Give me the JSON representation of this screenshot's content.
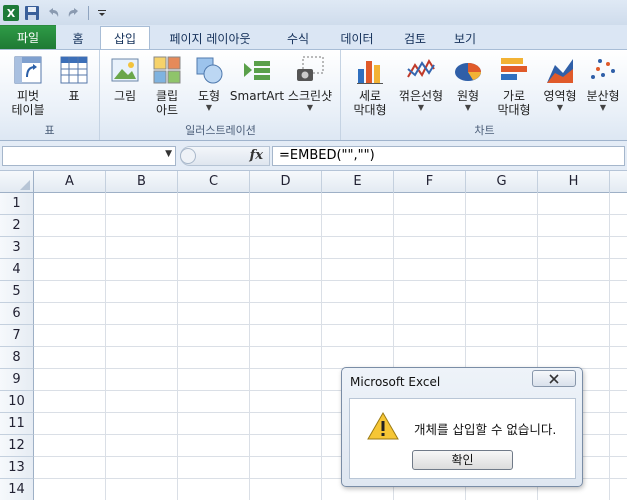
{
  "qat": {
    "icons": [
      "excel-logo-icon",
      "save-icon",
      "undo-icon",
      "redo-icon",
      "customize-qat-icon"
    ]
  },
  "tabs": {
    "file": "파일",
    "items": [
      "홈",
      "삽입",
      "페이지 레이아웃",
      "수식",
      "데이터",
      "검토",
      "보기"
    ],
    "active": "삽입"
  },
  "ribbon": {
    "groups": {
      "tables": {
        "label": "표",
        "pivot_line1": "피벗",
        "pivot_line2": "테이블",
        "table": "표"
      },
      "illustrations": {
        "label": "일러스트레이션",
        "picture": "그림",
        "clipart_line1": "클립",
        "clipart_line2": "아트",
        "shapes": "도형",
        "smartart": "SmartArt",
        "screenshot": "스크린샷"
      },
      "charts": {
        "label": "차트",
        "column_line1": "세로",
        "column_line2": "막대형",
        "line": "꺾은선형",
        "pie": "원형",
        "bar_line1": "가로",
        "bar_line2": "막대형",
        "area": "영역형",
        "scatter": "분산형"
      }
    }
  },
  "formula_bar": {
    "name_box": "",
    "fx": "fx",
    "formula": "=EMBED(\"\",\"\")"
  },
  "grid": {
    "columns": [
      "A",
      "B",
      "C",
      "D",
      "E",
      "F",
      "G",
      "H"
    ],
    "rows": [
      "1",
      "2",
      "3",
      "4",
      "5",
      "6",
      "7",
      "8",
      "9",
      "10",
      "11",
      "12",
      "13",
      "14"
    ]
  },
  "dialog": {
    "title": "Microsoft Excel",
    "message": "개체를 삽입할 수 없습니다.",
    "ok": "확인"
  },
  "colors": {
    "file_tab": "#1f7a34",
    "ribbon_bg": "#e9f0f8",
    "header_bg": "#e3eaf2"
  }
}
